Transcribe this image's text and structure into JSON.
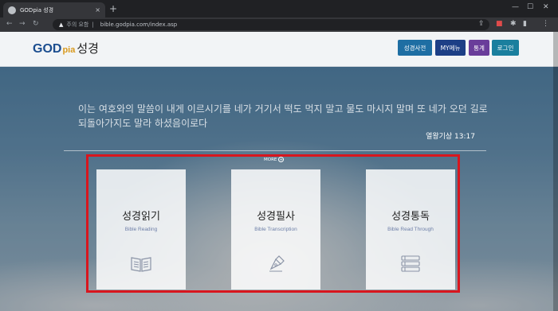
{
  "browser": {
    "tab_title": "GODpia 성경",
    "tab_close": "×",
    "new_tab": "+",
    "security_label": "주의 요함",
    "url": "bible.godpia.com/index.asp"
  },
  "header": {
    "logo_god": "GOD",
    "logo_pia": "pia",
    "logo_bible": "성경",
    "buttons": [
      {
        "label": "성경사전",
        "color": "#1e6ea3"
      },
      {
        "label": "MY메뉴",
        "color": "#1d3f86"
      },
      {
        "label": "통계",
        "color": "#6a3d9a"
      },
      {
        "label": "로그인",
        "color": "#1a7f9e"
      }
    ]
  },
  "verse": {
    "text": "이는 여호와의 말씀이 내게 이르시기를 네가 거기서 떡도 먹지 말고 물도 마시지 말며 또 네가 오던 길로 되돌아가지도 말라 하셨음이로다",
    "reference": "열왕기상 13:17",
    "more": "MORE"
  },
  "cards": [
    {
      "title": "성경읽기",
      "subtitle": "Bible Reading",
      "icon": "open-book-icon"
    },
    {
      "title": "성경필사",
      "subtitle": "Bible Transcription",
      "icon": "pen-nib-icon"
    },
    {
      "title": "성경통독",
      "subtitle": "Bible Read Through",
      "icon": "stacked-books-icon"
    }
  ],
  "colors": {
    "highlight": "#d8161e",
    "logo_blue": "#1b4d8f",
    "logo_gold": "#d99a1e"
  }
}
